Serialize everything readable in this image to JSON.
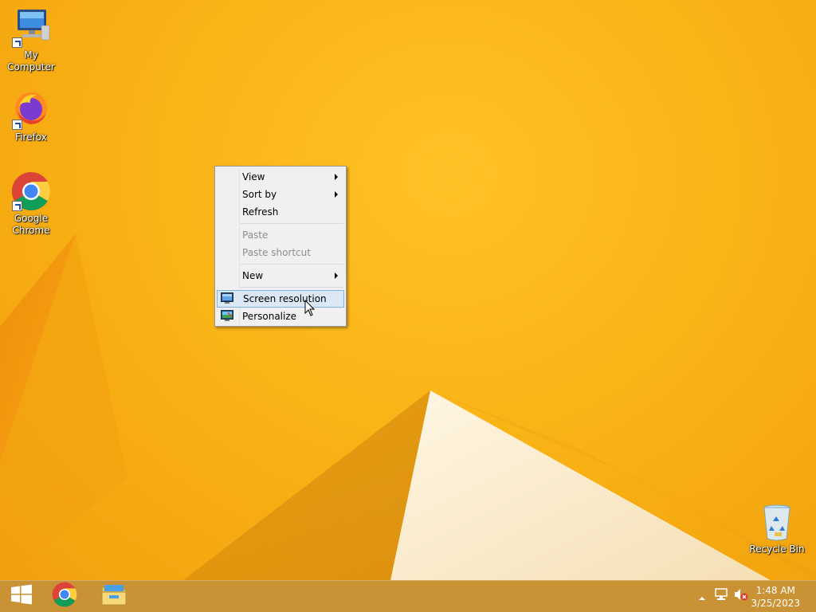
{
  "desktop": {
    "icons": [
      {
        "label": "My Computer",
        "icon": "computer-icon"
      },
      {
        "label": "Firefox",
        "icon": "firefox-icon"
      },
      {
        "label": "Google Chrome",
        "icon": "chrome-icon"
      },
      {
        "label": "Recycle Bin",
        "icon": "recycle-bin-icon"
      }
    ]
  },
  "context_menu": {
    "items": [
      {
        "label": "View",
        "submenu": true,
        "enabled": true
      },
      {
        "label": "Sort by",
        "submenu": true,
        "enabled": true
      },
      {
        "label": "Refresh",
        "submenu": false,
        "enabled": true
      },
      {
        "label": "Paste",
        "submenu": false,
        "enabled": false
      },
      {
        "label": "Paste shortcut",
        "submenu": false,
        "enabled": false
      },
      {
        "label": "New",
        "submenu": true,
        "enabled": true
      },
      {
        "label": "Screen resolution",
        "submenu": false,
        "enabled": true,
        "highlighted": true,
        "icon": "display-icon"
      },
      {
        "label": "Personalize",
        "submenu": false,
        "enabled": true,
        "icon": "personalize-icon"
      }
    ]
  },
  "taskbar": {
    "start_icon": "windows-logo-icon",
    "pinned": [
      {
        "name": "Google Chrome",
        "icon": "chrome-icon"
      },
      {
        "name": "File Explorer",
        "icon": "file-explorer-icon"
      }
    ],
    "tray": {
      "icons": [
        "show-hidden-icons-chevron",
        "network-icon",
        "volume-muted-icon"
      ],
      "time": "1:48 AM",
      "date": "3/25/2023"
    }
  },
  "colors": {
    "wallpaper": "#f5ad10",
    "taskbar": "#c99234",
    "menu_highlight": "#dbe8f5",
    "menu_highlight_border": "#7eb4ea"
  }
}
